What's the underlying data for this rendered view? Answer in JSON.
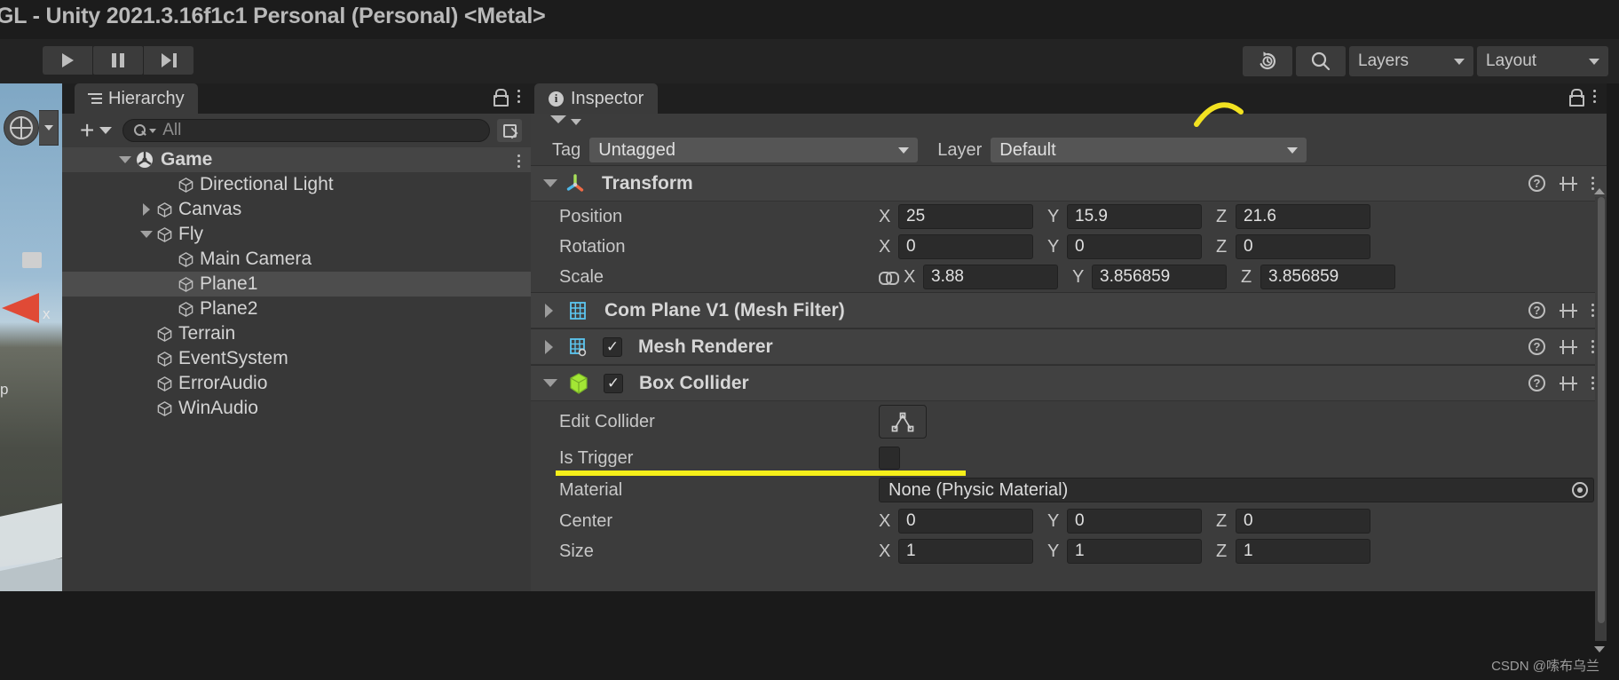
{
  "window": {
    "title": "GL - Unity 2021.3.16f1c1 Personal (Personal) <Metal>"
  },
  "toolbar": {
    "play_label": "play-icon",
    "pause_label": "pause-icon",
    "step_label": "step-icon",
    "history_icon": "undo-history-icon",
    "search_icon": "search-icon",
    "layers_label": "Layers",
    "layout_label": "Layout"
  },
  "scene_view": {
    "gizmo_icon": "scene-view-gizmo",
    "axis_x_label": "x",
    "axis_y_label": "p"
  },
  "hierarchy": {
    "tab_label": "Hierarchy",
    "add_label": "+",
    "search_value": "",
    "search_placeholder": "All",
    "items": [
      {
        "label": "Game",
        "depth": 0,
        "toggle": "down",
        "icon": "unity-scene-icon",
        "selected": false,
        "root": true
      },
      {
        "label": "Directional Light",
        "depth": 2,
        "toggle": "none",
        "icon": "gameobject-cube-icon",
        "selected": false,
        "root": false
      },
      {
        "label": "Canvas",
        "depth": 1,
        "toggle": "right",
        "icon": "gameobject-cube-icon",
        "selected": false,
        "root": false
      },
      {
        "label": "Fly",
        "depth": 1,
        "toggle": "down",
        "icon": "gameobject-cube-icon",
        "selected": false,
        "root": false
      },
      {
        "label": "Main Camera",
        "depth": 2,
        "toggle": "none",
        "icon": "gameobject-cube-icon",
        "selected": false,
        "root": false
      },
      {
        "label": "Plane1",
        "depth": 2,
        "toggle": "none",
        "icon": "gameobject-cube-icon",
        "selected": true,
        "root": false
      },
      {
        "label": "Plane2",
        "depth": 2,
        "toggle": "none",
        "icon": "gameobject-cube-icon",
        "selected": false,
        "root": false
      },
      {
        "label": "Terrain",
        "depth": 1,
        "toggle": "none",
        "icon": "gameobject-cube-icon",
        "selected": false,
        "root": false
      },
      {
        "label": "EventSystem",
        "depth": 1,
        "toggle": "none",
        "icon": "gameobject-cube-icon",
        "selected": false,
        "root": false
      },
      {
        "label": "ErrorAudio",
        "depth": 1,
        "toggle": "none",
        "icon": "gameobject-cube-icon",
        "selected": false,
        "root": false
      },
      {
        "label": "WinAudio",
        "depth": 1,
        "toggle": "none",
        "icon": "gameobject-cube-icon",
        "selected": false,
        "root": false
      }
    ]
  },
  "inspector": {
    "tab_label": "Inspector",
    "tag_label": "Tag",
    "tag_value": "Untagged",
    "layer_label": "Layer",
    "layer_value": "Default",
    "transform": {
      "title": "Transform",
      "position_label": "Position",
      "position": {
        "x": "25",
        "y": "15.9",
        "z": "21.6"
      },
      "rotation_label": "Rotation",
      "rotation": {
        "x": "0",
        "y": "0",
        "z": "0"
      },
      "scale_label": "Scale",
      "scale": {
        "x": "3.88",
        "y": "3.856859",
        "z": "3.856859"
      },
      "axis_x": "X",
      "axis_y": "Y",
      "axis_z": "Z"
    },
    "mesh_filter": {
      "title": "Com Plane V1 (Mesh Filter)"
    },
    "mesh_renderer": {
      "title": "Mesh Renderer",
      "enabled": "✓"
    },
    "box_collider": {
      "title": "Box Collider",
      "enabled": "✓",
      "edit_collider_label": "Edit Collider",
      "is_trigger_label": "Is Trigger",
      "material_label": "Material",
      "material_value": "None (Physic Material)",
      "center_label": "Center",
      "center": {
        "x": "0",
        "y": "0",
        "z": "0"
      },
      "size_label": "Size",
      "size": {
        "x": "1",
        "y": "1",
        "z": "1"
      }
    }
  },
  "watermark": {
    "text": "CSDN @嗦布乌兰"
  },
  "colors": {
    "accent_yellow": "#f6ef1a",
    "panel_bg": "#3c3c3c",
    "hierarchy_bg": "#383838",
    "selection": "#4d4d4d",
    "collider_green": "#a3e635",
    "mesh_blue": "#5cc6f0"
  }
}
